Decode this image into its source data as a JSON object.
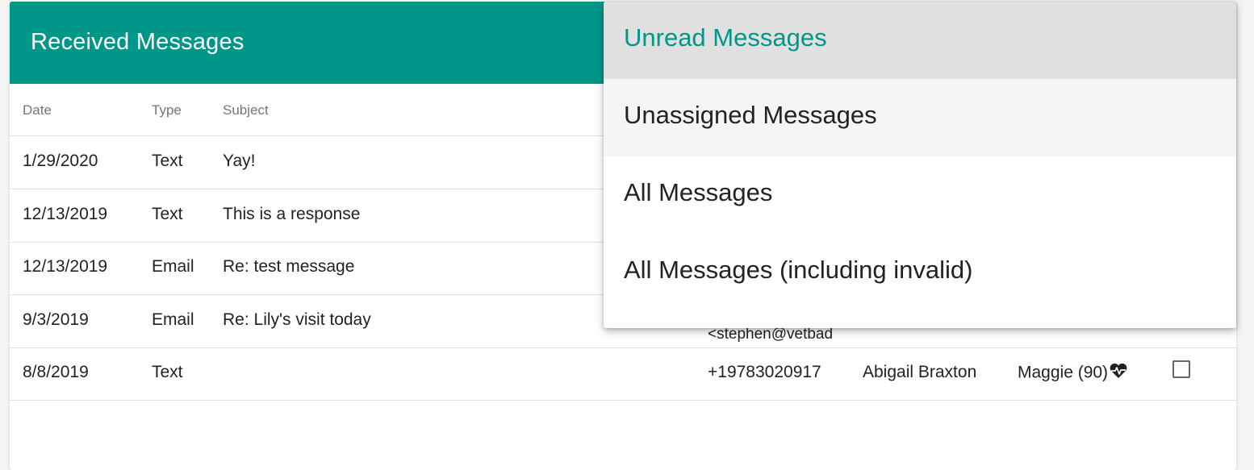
{
  "card": {
    "title": "Received Messages"
  },
  "columns": {
    "date": "Date",
    "type": "Type",
    "subject": "Subject"
  },
  "rows": [
    {
      "date": "1/29/2020",
      "type": "Text",
      "subject": "Yay!"
    },
    {
      "date": "12/13/2019",
      "type": "Text",
      "subject": "This is a response"
    },
    {
      "date": "12/13/2019",
      "type": "Email",
      "subject": "Re: test message"
    },
    {
      "date": "9/3/2019",
      "type": "Email",
      "subject": "Re: Lily's visit today",
      "from_partial": "<stephen@vetbad"
    },
    {
      "date": "8/8/2019",
      "type": "Text",
      "subject": "",
      "from": "+19783020917",
      "client": "Abigail Braxton",
      "patient": "Maggie (90)",
      "patient_icon": "heartbeat-icon"
    }
  ],
  "dropdown": {
    "selected_index": 0,
    "options": [
      "Unread Messages",
      "Unassigned Messages",
      "All Messages",
      "All Messages (including invalid)"
    ]
  },
  "colors": {
    "accent": "#009688",
    "header_text": "#ffffff",
    "muted": "#757575"
  }
}
